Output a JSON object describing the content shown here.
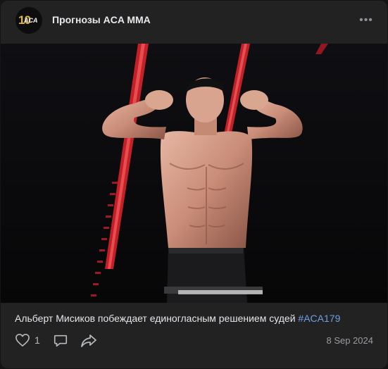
{
  "post": {
    "author": "Прогнозы ACA MMA",
    "avatar_text_number": "10",
    "avatar_text_brand": "ACA",
    "more_label": "•••",
    "text": "Альберт Мисиков побеждает единогласным решением судей",
    "hashtag": "#ACA179",
    "likes": "1",
    "date": "8 Sep 2024"
  },
  "icons": {
    "more": "more-dots-icon",
    "like": "heart-icon",
    "comment": "comment-icon",
    "share": "share-icon"
  },
  "colors": {
    "card_background": "#222222",
    "page_background": "#141414",
    "hashtag": "#6ea0e6",
    "photo_accent_red": "#e0242c"
  }
}
